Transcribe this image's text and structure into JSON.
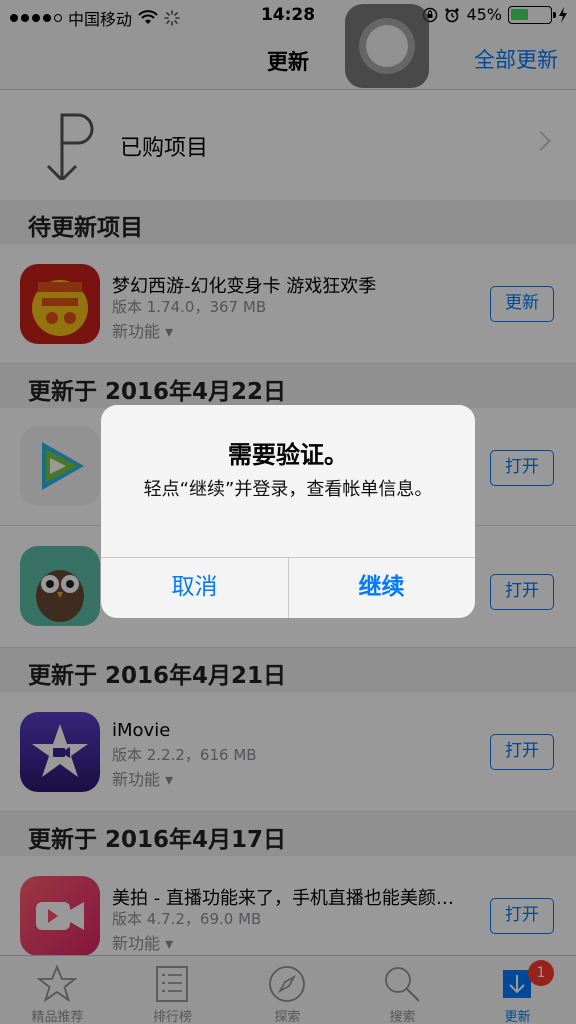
{
  "status_bar": {
    "carrier": "中国移动",
    "time": "14:28",
    "battery": "45%",
    "battery_level": 0.45
  },
  "nav": {
    "title": "更新",
    "update_all": "全部更新"
  },
  "purchased": {
    "label": "已购项目"
  },
  "sections": {
    "pending": "待更新项目",
    "apr22": "更新于 2016年4月22日",
    "apr21": "更新于 2016年4月21日",
    "apr17": "更新于 2016年4月17日"
  },
  "apps": [
    {
      "name": "梦幻西游-幻化变身卡 游戏狂欢季",
      "version": "版本 1.74.0，367 MB",
      "features": "新功能 ▾",
      "button": "更新",
      "icon": "menghuan-icon"
    },
    {
      "name": "",
      "version": "",
      "features": "",
      "button": "打开",
      "icon": "tencent-video-icon"
    },
    {
      "name": "",
      "version": "",
      "features": "",
      "button": "打开",
      "icon": "owl-icon"
    },
    {
      "name": "iMovie",
      "version": "版本 2.2.2，616 MB",
      "features": "新功能 ▾",
      "button": "打开",
      "icon": "imovie-icon"
    },
    {
      "name": "美拍 - 直播功能来了，手机直播也能美颜…",
      "version": "版本 4.7.2，69.0 MB",
      "features": "新功能 ▾",
      "button": "打开",
      "icon": "meipai-icon"
    }
  ],
  "tabs": [
    {
      "label": "精品推荐",
      "icon": "star-icon"
    },
    {
      "label": "排行榜",
      "icon": "list-icon"
    },
    {
      "label": "探索",
      "icon": "compass-icon"
    },
    {
      "label": "搜索",
      "icon": "search-icon"
    },
    {
      "label": "更新",
      "icon": "download-icon",
      "badge": "1"
    }
  ],
  "alert": {
    "title": "需要验证。",
    "message": "轻点“继续”并登录，查看帐单信息。",
    "cancel": "取消",
    "continue": "继续"
  },
  "colors": {
    "accent": "#007aff",
    "badge": "#ff3b30"
  }
}
